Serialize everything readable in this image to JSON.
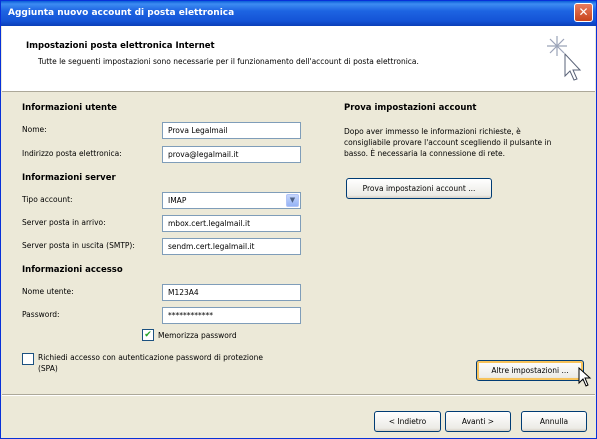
{
  "window": {
    "title": "Aggiunta nuovo account di posta elettronica",
    "close_symbol": "✕"
  },
  "header": {
    "title": "Impostazioni posta elettronica Internet",
    "subtitle": "Tutte le seguenti impostazioni sono necessarie per il funzionamento dell'account di posta elettronica."
  },
  "user_info": {
    "section": "Informazioni utente",
    "name_label": "Nome:",
    "name_value": "Prova Legalmail",
    "email_label": "Indirizzo posta elettronica:",
    "email_value": "prova@legalmail.it"
  },
  "server_info": {
    "section": "Informazioni server",
    "account_type_label": "Tipo account:",
    "account_type_value": "IMAP",
    "incoming_label": "Server posta in arrivo:",
    "incoming_value": "mbox.cert.legalmail.it",
    "outgoing_label": "Server posta in uscita (SMTP):",
    "outgoing_value": "sendm.cert.legalmail.it"
  },
  "login_info": {
    "section": "Informazioni accesso",
    "username_label": "Nome utente:",
    "username_value": "M123A4",
    "password_label": "Password:",
    "password_value": "************",
    "remember_label": "Memorizza password",
    "remember_checked": true
  },
  "spa": {
    "label_line1": "Richiedi accesso con autenticazione password di protezione",
    "label_line2": "(SPA)",
    "checked": false
  },
  "test_settings": {
    "section": "Prova impostazioni account",
    "line1": "Dopo aver immesso le informazioni richieste, è",
    "line2": "consigliabile provare l'account scegliendo il pulsante in",
    "line3": "basso. È necessaria la connessione di rete.",
    "button": "Prova impostazioni account ..."
  },
  "more_settings_button": "Altre impostazioni ...",
  "footer": {
    "back": "< Indietro",
    "next": "Avanti >",
    "cancel": "Annulla"
  },
  "icons": {
    "check": "✔",
    "dropdown": "▼"
  }
}
